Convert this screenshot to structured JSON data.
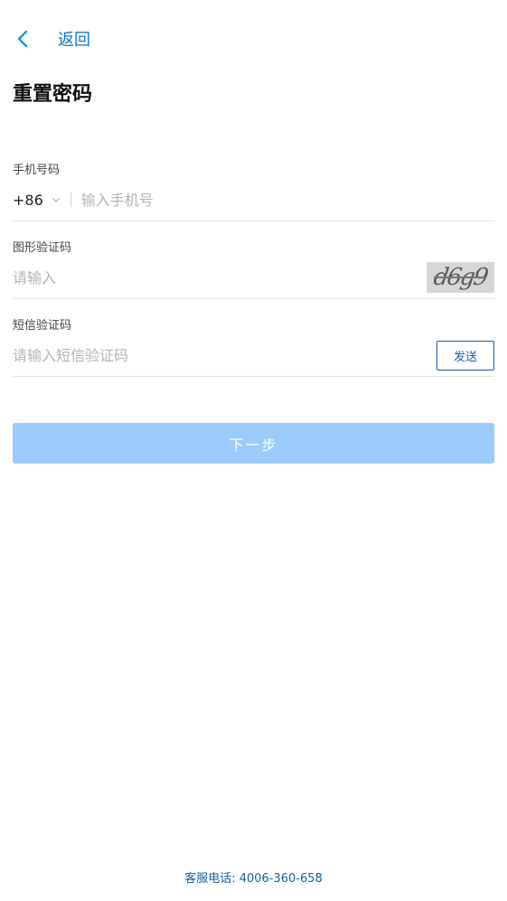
{
  "nav": {
    "back_label": "返回",
    "back_icon": "chevron-left-icon"
  },
  "page_title": "重置密码",
  "phone_field": {
    "label": "手机号码",
    "country_code": "+86",
    "dropdown_icon": "chevron-down-icon",
    "placeholder": "输入手机号",
    "value": ""
  },
  "captcha_field": {
    "label": "图形验证码",
    "placeholder": "请输入",
    "value": "",
    "captcha_text": "d6g9"
  },
  "sms_field": {
    "label": "短信验证码",
    "placeholder": "请输入短信验证码",
    "value": "",
    "send_label": "发送"
  },
  "next_button": {
    "label": "下一步"
  },
  "footer": {
    "service_label": "客服电话:",
    "service_phone": "4006-360-658"
  },
  "colors": {
    "accent_blue": "#1a73c8",
    "link_blue": "#1a5fa8",
    "button_disabled": "#9acbfb",
    "divider": "#e5e5e5",
    "placeholder": "#b5b5b5"
  }
}
